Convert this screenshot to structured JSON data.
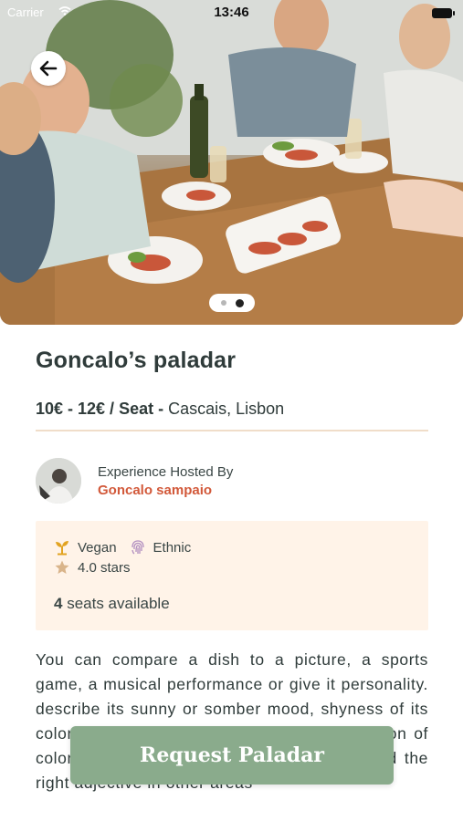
{
  "status_bar": {
    "carrier": "Carrier",
    "time": "13:46"
  },
  "hero": {
    "image": "group-dinner-photo",
    "pager": {
      "count": 2,
      "active_index": 1
    }
  },
  "experience": {
    "title": "Goncalo’s paladar",
    "price_range": "10€ - 12€ / Seat -",
    "location": "Cascais, Lisbon"
  },
  "host": {
    "label": "Experience Hosted By",
    "name": "Goncalo sampaio"
  },
  "info": {
    "tags": [
      {
        "label": "Vegan",
        "icon": "sprout-icon"
      },
      {
        "label": "Ethnic",
        "icon": "fingerprint-icon"
      }
    ],
    "rating": {
      "label": "4.0 stars",
      "icon": "star-icon"
    },
    "seats_count": "4",
    "seats_label": "seats available"
  },
  "description": "You can compare a dish to a picture, a sports game, a musical performance or give it personality. describe its sunny or somber mood, shyness of its colors, the boldness of flavors. this comparison of colors, tastes and flavors will help you to find the right adjective in other areas",
  "cta": {
    "label": "Request Paladar"
  },
  "colors": {
    "accent": "#d2593a",
    "cta_bg": "#8aab8c",
    "card_bg": "#fff3e8",
    "divider": "#f0ddc9"
  }
}
